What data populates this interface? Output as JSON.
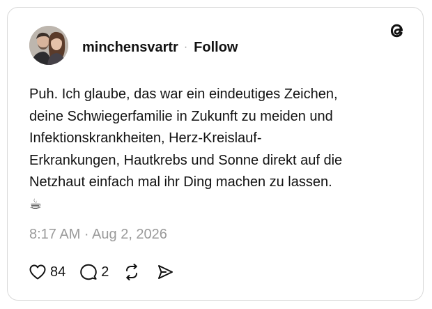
{
  "post": {
    "username": "minchensvartr",
    "separator": "·",
    "follow_label": "Follow",
    "text": "Puh. Ich glaube, das war ein eindeutiges Zeichen,\ndeine Schwiegerfamilie in Zukunft zu meiden und\nInfektionskrankheiten, Herz-Kreislauf-\nErkrankungen, Hautkrebs und Sonne direkt auf die\nNetzhaut einfach mal ihr Ding machen zu lassen.",
    "emoji": "☕",
    "timestamp": "8:17 AM · Aug 2, 2026"
  },
  "actions": {
    "likes": "84",
    "replies": "2"
  },
  "icons": {
    "brand": "threads-logo-icon",
    "like": "heart-icon",
    "reply": "speech-bubble-icon",
    "repost": "repost-icon",
    "share": "send-icon"
  },
  "colors": {
    "text": "#111111",
    "muted": "#9a9a9a",
    "border": "#d9d9d9"
  }
}
